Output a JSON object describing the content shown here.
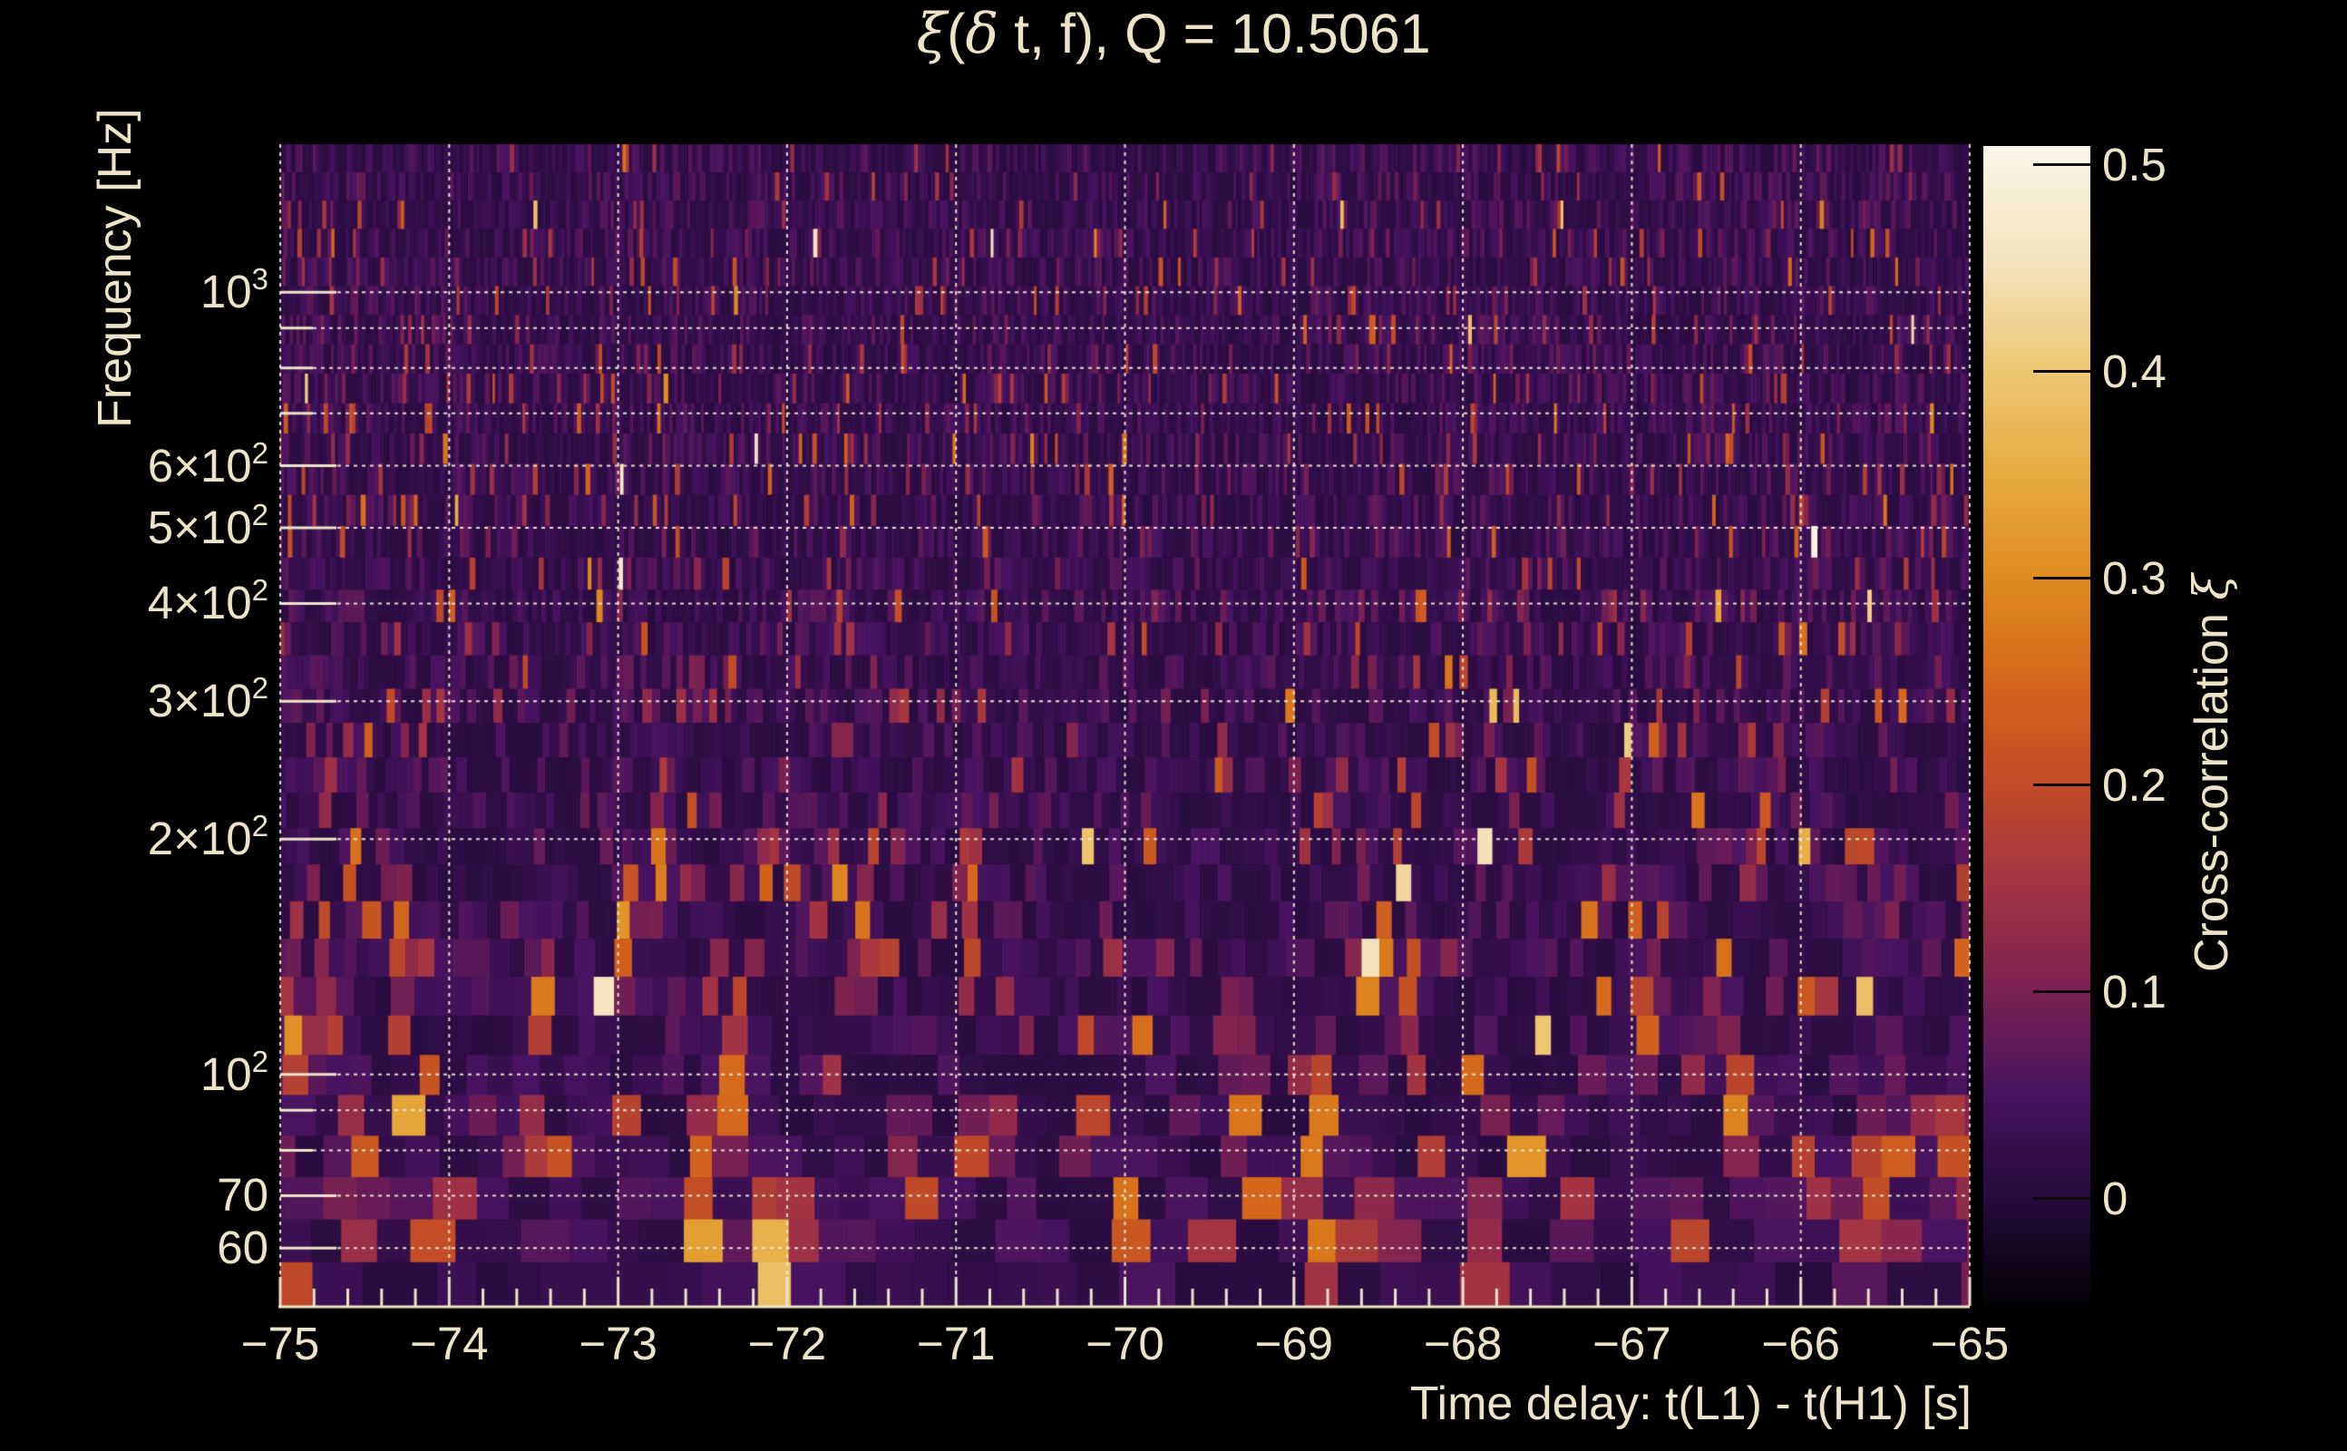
{
  "figure": {
    "background": "#000000",
    "text_color": "#ece4c8",
    "grid_color": "#f2ead2"
  },
  "title": {
    "text": "ξ(δ t, f), Q = 10.5061",
    "parts": [
      {
        "t": "ξ",
        "greek": true
      },
      {
        "t": "(",
        "greek": false
      },
      {
        "t": "δ",
        "greek": true
      },
      {
        "t": " t, f), Q = 10.5061",
        "greek": false
      }
    ]
  },
  "x_axis": {
    "title": "Time delay: t(L1) - t(H1) [s]",
    "range_s": [
      -75,
      -65
    ],
    "minor_tick_step_s": 0.2,
    "ticks": [
      {
        "v": -75,
        "label": "−75"
      },
      {
        "v": -74,
        "label": "−74"
      },
      {
        "v": -73,
        "label": "−73"
      },
      {
        "v": -72,
        "label": "−72"
      },
      {
        "v": -71,
        "label": "−71"
      },
      {
        "v": -70,
        "label": "−70"
      },
      {
        "v": -69,
        "label": "−69"
      },
      {
        "v": -68,
        "label": "−68"
      },
      {
        "v": -67,
        "label": "−67"
      },
      {
        "v": -66,
        "label": "−66"
      },
      {
        "v": -65,
        "label": "−65"
      }
    ]
  },
  "y_axis": {
    "title": "Frequency [Hz]",
    "scale": "log",
    "range_hz": [
      50.6,
      1546
    ],
    "ticks": [
      {
        "hz": 1000,
        "base": "10",
        "sup": "3"
      },
      {
        "hz": 600,
        "base": "6×10",
        "sup": "2"
      },
      {
        "hz": 500,
        "base": "5×10",
        "sup": "2"
      },
      {
        "hz": 400,
        "base": "4×10",
        "sup": "2"
      },
      {
        "hz": 300,
        "base": "3×10",
        "sup": "2"
      },
      {
        "hz": 200,
        "base": "2×10",
        "sup": "2"
      },
      {
        "hz": 100,
        "base": "10",
        "sup": "2"
      },
      {
        "hz": 70,
        "base": "70",
        "sup": ""
      },
      {
        "hz": 60,
        "base": "60",
        "sup": ""
      }
    ],
    "grid_only_hz": [
      900,
      800,
      700,
      90,
      80
    ]
  },
  "colorbar": {
    "title": "Cross-correlation ξ",
    "title_parts": [
      {
        "t": "Cross-correlation ",
        "greek": false
      },
      {
        "t": "ξ",
        "greek": true
      }
    ],
    "range": [
      -0.051,
      0.509
    ],
    "ticks": [
      {
        "v": 0.5,
        "label": "0.5"
      },
      {
        "v": 0.4,
        "label": "0.4"
      },
      {
        "v": 0.3,
        "label": "0.3"
      },
      {
        "v": 0.2,
        "label": "0.2"
      },
      {
        "v": 0.1,
        "label": "0.1"
      },
      {
        "v": 0.0,
        "label": "0"
      }
    ],
    "colormap": [
      {
        "v": -0.051,
        "c": "#040207"
      },
      {
        "v": 0.0,
        "c": "#250b3b"
      },
      {
        "v": 0.05,
        "c": "#471360"
      },
      {
        "v": 0.1,
        "c": "#7b2151"
      },
      {
        "v": 0.15,
        "c": "#a23344"
      },
      {
        "v": 0.2,
        "c": "#c04b27"
      },
      {
        "v": 0.25,
        "c": "#d4671c"
      },
      {
        "v": 0.3,
        "c": "#df8b1f"
      },
      {
        "v": 0.35,
        "c": "#e7ab40"
      },
      {
        "v": 0.4,
        "c": "#edc772"
      },
      {
        "v": 0.45,
        "c": "#f4e2ba"
      },
      {
        "v": 0.509,
        "c": "#faf6ea"
      }
    ]
  },
  "chart_data": {
    "type": "heatmap",
    "title": "ξ(δ t, f), Q = 10.5061",
    "q_value": 10.5061,
    "xlabel": "Time delay: t(L1) - t(H1) [s]",
    "ylabel": "Frequency [Hz]",
    "colorbar_label": "Cross-correlation ξ",
    "x_range_s": [
      -75,
      -65
    ],
    "y_range_hz": [
      50.6,
      1546
    ],
    "y_scale": "log",
    "color_range": [
      -0.051,
      0.509
    ],
    "grid": true,
    "legend_position": "right-colorbar",
    "background_description": "dense Q-transform tiling; most tiles ξ ≈ 0–0.1 (dark purple) with vertical streaks ξ ≈ 0.1–0.25, brighter activity below 200 Hz",
    "hotspots": [
      {
        "t": -74.93,
        "f_hz": 112,
        "xi": 0.3,
        "wt": 0.05,
        "wf": 0.05
      },
      {
        "t": -74.55,
        "f_hz": 74,
        "xi": 0.34,
        "wt": 0.06,
        "wf": 0.06
      },
      {
        "t": -74.28,
        "f_hz": 150,
        "xi": 0.26,
        "wt": 0.04,
        "wf": 0.05
      },
      {
        "t": -74.05,
        "f_hz": 62,
        "xi": 0.3,
        "wt": 0.05,
        "wf": 0.05
      },
      {
        "t": -73.45,
        "f_hz": 125,
        "xi": 0.27,
        "wt": 0.04,
        "wf": 0.05
      },
      {
        "t": -72.94,
        "f_hz": 154,
        "xi": 0.44,
        "wt": 0.035,
        "wf": 0.05
      },
      {
        "t": -72.75,
        "f_hz": 185,
        "xi": 0.3,
        "wt": 0.04,
        "wf": 0.05
      },
      {
        "t": -72.47,
        "f_hz": 71,
        "xi": 0.42,
        "wt": 0.045,
        "wf": 0.07
      },
      {
        "t": -72.3,
        "f_hz": 95,
        "xi": 0.3,
        "wt": 0.05,
        "wf": 0.06
      },
      {
        "t": -72.07,
        "f_hz": 57,
        "xi": 0.4,
        "wt": 0.12,
        "wf": 0.07
      },
      {
        "t": -72.02,
        "f_hz": 52,
        "xi": 0.5,
        "wt": 0.04,
        "wf": 0.06
      },
      {
        "t": -71.55,
        "f_hz": 150,
        "xi": 0.28,
        "wt": 0.04,
        "wf": 0.05
      },
      {
        "t": -71.25,
        "f_hz": 72,
        "xi": 0.3,
        "wt": 0.05,
        "wf": 0.06
      },
      {
        "t": -70.92,
        "f_hz": 180,
        "xi": 0.27,
        "wt": 0.04,
        "wf": 0.05
      },
      {
        "t": -70.02,
        "f_hz": 61,
        "xi": 0.4,
        "wt": 0.05,
        "wf": 0.07
      },
      {
        "t": -69.3,
        "f_hz": 92,
        "xi": 0.28,
        "wt": 0.05,
        "wf": 0.06
      },
      {
        "t": -68.85,
        "f_hz": 75,
        "xi": 0.4,
        "wt": 0.05,
        "wf": 0.1
      },
      {
        "t": -68.3,
        "f_hz": 130,
        "xi": 0.26,
        "wt": 0.04,
        "wf": 0.05
      },
      {
        "t": -67.95,
        "f_hz": 56,
        "xi": 0.36,
        "wt": 0.06,
        "wf": 0.06
      },
      {
        "t": -66.9,
        "f_hz": 120,
        "xi": 0.27,
        "wt": 0.05,
        "wf": 0.05
      },
      {
        "t": -66.4,
        "f_hz": 92,
        "xi": 0.3,
        "wt": 0.05,
        "wf": 0.06
      },
      {
        "t": -65.6,
        "f_hz": 68,
        "xi": 0.3,
        "wt": 0.05,
        "wf": 0.06
      },
      {
        "t": -65.05,
        "f_hz": 69,
        "xi": 0.38,
        "wt": 0.05,
        "wf": 0.07
      }
    ]
  }
}
